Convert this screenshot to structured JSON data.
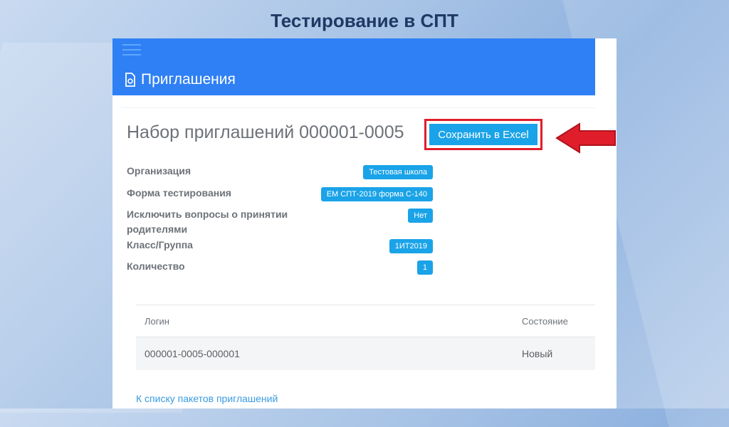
{
  "slide": {
    "title": "Тестирование в СПТ"
  },
  "topbar": {
    "title": "Приглашения"
  },
  "card": {
    "heading": "Набор приглашений 000001-0005",
    "export_button": "Сохранить в Excel",
    "properties": [
      {
        "label": "Организация",
        "value": "Тестовая школа"
      },
      {
        "label": "Форма тестирования",
        "value": "ЕМ СПТ-2019 форма С-140"
      },
      {
        "label": "Исключить вопросы о принятии родителями",
        "value": "Нет"
      },
      {
        "label": "Класс/Группа",
        "value": "1ИТ2019"
      },
      {
        "label": "Количество",
        "value": "1"
      }
    ],
    "table": {
      "columns": [
        "Логин",
        "Состояние"
      ],
      "rows": [
        {
          "login": "000001-0005-000001",
          "state": "Новый"
        }
      ]
    },
    "back_link": "К списку пакетов приглашений"
  },
  "colors": {
    "topbar": "#2f80f5",
    "badge": "#1aa3e8",
    "highlight": "#e01e2b",
    "link": "#3a9be0"
  },
  "icons": {
    "menu": "hamburger-icon",
    "invites": "invitation-icon",
    "pointer": "red-arrow"
  }
}
